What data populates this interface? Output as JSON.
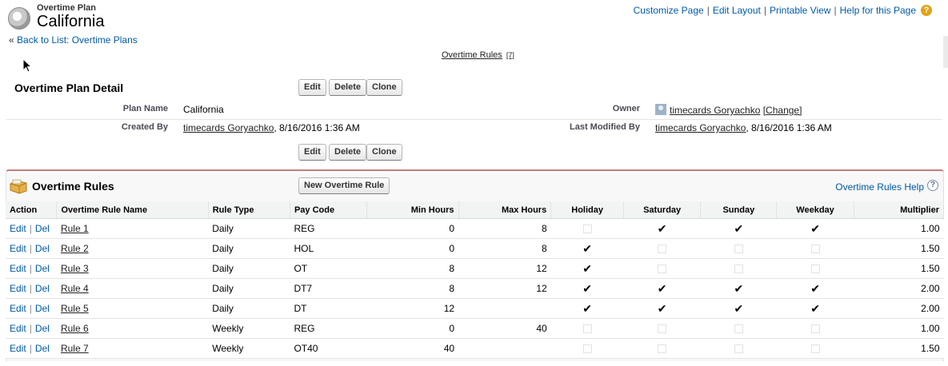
{
  "header": {
    "subtitle": "Overtime Plan",
    "title": "California",
    "links": [
      "Customize Page",
      "Edit Layout",
      "Printable View",
      "Help for this Page"
    ],
    "back_prefix": "«",
    "back_link": "Back to List: Overtime Plans"
  },
  "related_links": {
    "label": "Overtime Rules",
    "count": "[7]"
  },
  "detail": {
    "title": "Overtime Plan Detail",
    "buttons": {
      "edit": "Edit",
      "delete": "Delete",
      "clone": "Clone"
    },
    "fields": {
      "plan_name_label": "Plan Name",
      "plan_name_value": "California",
      "owner_label": "Owner",
      "owner_value": "timecards Goryachko",
      "owner_change": "[Change]",
      "created_by_label": "Created By",
      "created_by_user": "timecards Goryachko",
      "created_by_date": ", 8/16/2016 1:36 AM",
      "modified_by_label": "Last Modified By",
      "modified_by_user": "timecards Goryachko",
      "modified_by_date": ", 8/16/2016 1:36 AM"
    }
  },
  "rules_list": {
    "title": "Overtime Rules",
    "new_button": "New Overtime Rule",
    "help_link": "Overtime Rules Help",
    "help_icon": "?",
    "action_edit": "Edit",
    "action_sep": "|",
    "action_del": "Del",
    "columns": [
      "Action",
      "Overtime Rule Name",
      "Rule Type",
      "Pay Code",
      "Min Hours",
      "Max Hours",
      "Holiday",
      "Saturday",
      "Sunday",
      "Weekday",
      "Multiplier"
    ],
    "rows": [
      {
        "name": "Rule 1",
        "type": "Daily",
        "pay_code": "REG",
        "min": "0",
        "max": "8",
        "holiday": false,
        "saturday": true,
        "sunday": true,
        "weekday": true,
        "multiplier": "1.00"
      },
      {
        "name": "Rule 2",
        "type": "Daily",
        "pay_code": "HOL",
        "min": "0",
        "max": "8",
        "holiday": true,
        "saturday": false,
        "sunday": false,
        "weekday": false,
        "multiplier": "1.50"
      },
      {
        "name": "Rule 3",
        "type": "Daily",
        "pay_code": "OT",
        "min": "8",
        "max": "12",
        "holiday": true,
        "saturday": false,
        "sunday": false,
        "weekday": false,
        "multiplier": "1.50"
      },
      {
        "name": "Rule 4",
        "type": "Daily",
        "pay_code": "DT7",
        "min": "8",
        "max": "12",
        "holiday": true,
        "saturday": true,
        "sunday": true,
        "weekday": true,
        "multiplier": "2.00"
      },
      {
        "name": "Rule 5",
        "type": "Daily",
        "pay_code": "DT",
        "min": "12",
        "max": "",
        "holiday": true,
        "saturday": true,
        "sunday": true,
        "weekday": true,
        "multiplier": "2.00"
      },
      {
        "name": "Rule 6",
        "type": "Weekly",
        "pay_code": "REG",
        "min": "0",
        "max": "40",
        "holiday": false,
        "saturday": false,
        "sunday": false,
        "weekday": false,
        "multiplier": "1.00"
      },
      {
        "name": "Rule 7",
        "type": "Weekly",
        "pay_code": "OT40",
        "min": "40",
        "max": "",
        "holiday": false,
        "saturday": false,
        "sunday": false,
        "weekday": false,
        "multiplier": "1.50"
      }
    ]
  },
  "icons": {
    "checked": "✔",
    "page_icon": "cd-icon",
    "list_icon": "folder-icon"
  },
  "colors": {
    "link": "#015ba7",
    "list_accent": "#c37f7f"
  }
}
